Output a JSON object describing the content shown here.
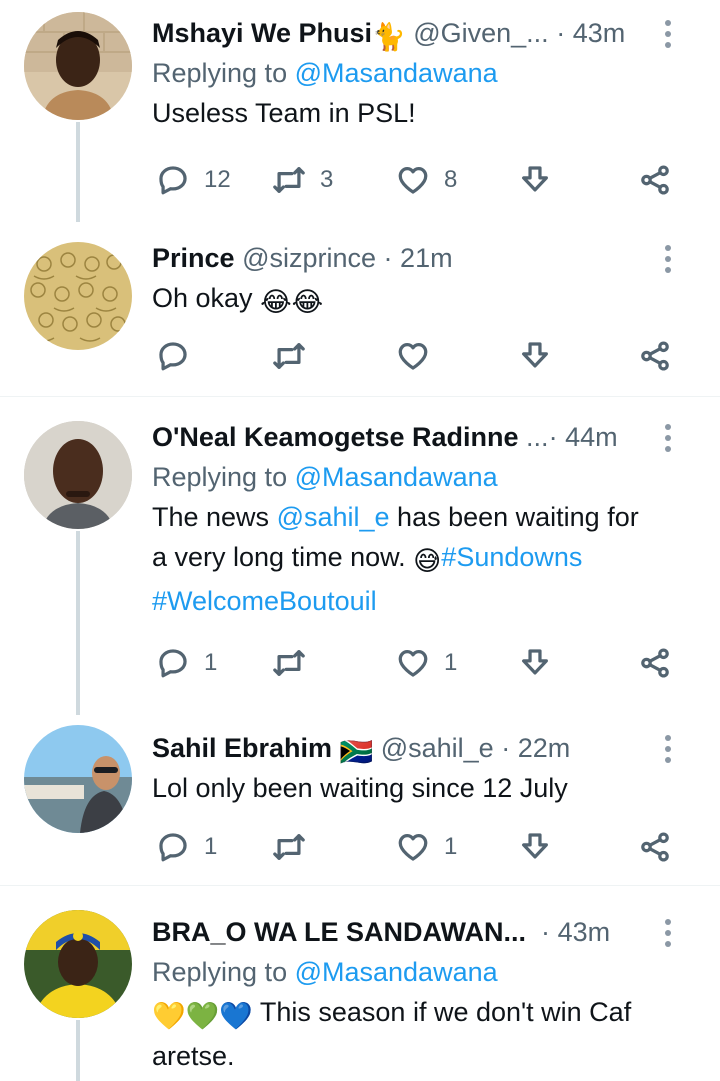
{
  "tweets": [
    {
      "name": "Mshayi We Phusi",
      "name_emoji": "🐈",
      "handle": "@Given_...",
      "time": "43m",
      "replying_prefix": "Replying to ",
      "replying_to": "@Masandawana",
      "text": "Useless Team in PSL!",
      "replies": "12",
      "retweets": "3",
      "likes": "8"
    },
    {
      "name": "Prince",
      "handle": "@sizprince",
      "time": "21m",
      "text": "Oh okay",
      "text_emoji": "😂😂",
      "replies": "",
      "retweets": "",
      "likes": ""
    },
    {
      "name": "O'Neal Keamogetse Radinne",
      "name_trunc": "...",
      "time": "44m",
      "replying_prefix": "Replying to ",
      "replying_to": "@Masandawana",
      "text_a": "The news ",
      "text_mention": "@sahil_e",
      "text_b": " has been waiting for",
      "text_c": "a very long time now. ",
      "text_emoji": "😅",
      "hashtag1": "#Sundowns",
      "hashtag2": "#WelcomeBoutouil",
      "replies": "1",
      "retweets": "",
      "likes": "1"
    },
    {
      "name": "Sahil Ebrahim",
      "name_emoji": "🇿🇦",
      "handle": "@sahil_e",
      "time": "22m",
      "text": "Lol only been waiting since 12 July",
      "replies": "1",
      "retweets": "",
      "likes": "1"
    },
    {
      "name": "BRA_O WA LE SANDAWAN...",
      "time": "43m",
      "replying_prefix": "Replying to ",
      "replying_to": "@Masandawana",
      "text_emoji": "💛💚💙",
      "text_a": " This season if we don't win Caf",
      "text_b": "aretse."
    }
  ],
  "separator": "·",
  "icons": [
    "reply-icon",
    "retweet-icon",
    "like-icon",
    "download-icon",
    "share-icon",
    "more-options-icon"
  ],
  "colors": {
    "link": "#1d9bf0",
    "secondary": "#536471",
    "thread_line": "#cfd9de",
    "divider": "#eff3f4"
  }
}
